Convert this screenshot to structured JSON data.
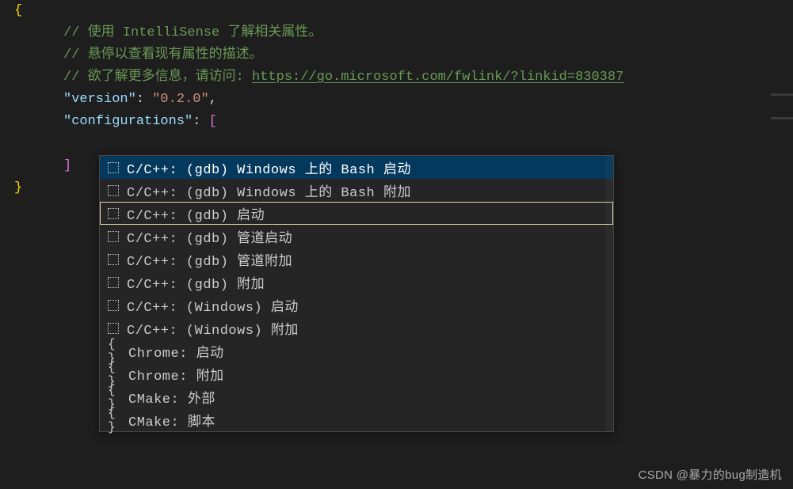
{
  "code": {
    "open_brace": "{",
    "comment1": "// 使用 IntelliSense 了解相关属性。",
    "comment2": "// 悬停以查看现有属性的描述。",
    "comment3_prefix": "// 欲了解更多信息，请访问: ",
    "comment3_link": "https://go.microsoft.com/fwlink/?linkid=830387",
    "version_key": "\"version\"",
    "version_val": "\"0.2.0\"",
    "configurations_key": "\"configurations\"",
    "open_bracket": "[",
    "close_bracket": "]",
    "close_brace": "}",
    "colon": ":",
    "comma": ","
  },
  "suggest": {
    "items": [
      {
        "icon": "square",
        "label": "C/C++: (gdb) Windows 上的 Bash 启动",
        "selected": true,
        "highlighted": false
      },
      {
        "icon": "square",
        "label": "C/C++: (gdb) Windows 上的 Bash 附加",
        "selected": false,
        "highlighted": false
      },
      {
        "icon": "square",
        "label": "C/C++: (gdb) 启动",
        "selected": false,
        "highlighted": true
      },
      {
        "icon": "square",
        "label": "C/C++: (gdb) 管道启动",
        "selected": false,
        "highlighted": false
      },
      {
        "icon": "square",
        "label": "C/C++: (gdb) 管道附加",
        "selected": false,
        "highlighted": false
      },
      {
        "icon": "square",
        "label": "C/C++: (gdb) 附加",
        "selected": false,
        "highlighted": false
      },
      {
        "icon": "square",
        "label": "C/C++: (Windows) 启动",
        "selected": false,
        "highlighted": false
      },
      {
        "icon": "square",
        "label": "C/C++: (Windows) 附加",
        "selected": false,
        "highlighted": false
      },
      {
        "icon": "braces",
        "label": "Chrome: 启动",
        "selected": false,
        "highlighted": false
      },
      {
        "icon": "braces",
        "label": "Chrome: 附加",
        "selected": false,
        "highlighted": false
      },
      {
        "icon": "braces",
        "label": "CMake: 外部",
        "selected": false,
        "highlighted": false
      },
      {
        "icon": "braces",
        "label": "CMake: 脚本",
        "selected": false,
        "highlighted": false
      }
    ]
  },
  "watermark": "CSDN @暴力的bug制造机"
}
